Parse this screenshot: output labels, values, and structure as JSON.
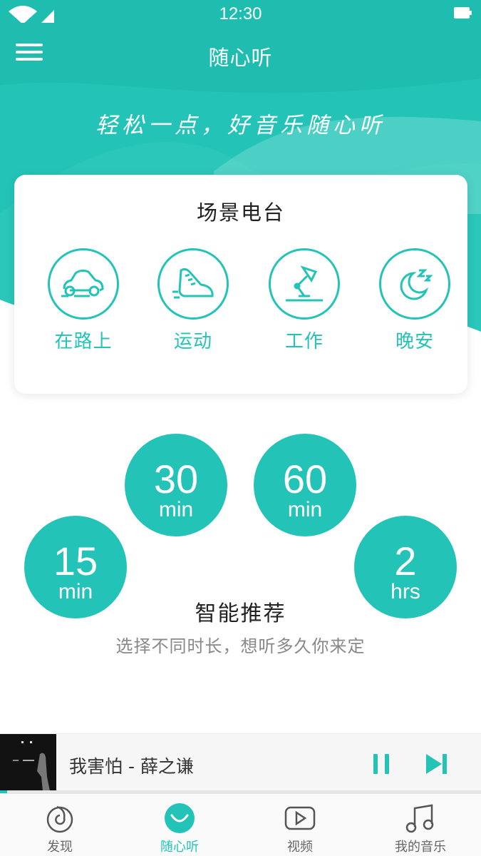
{
  "status_bar": {
    "time": "12:30"
  },
  "nav": {
    "title": "随心听"
  },
  "hero": {
    "slogan": "轻松一点，好音乐随心听"
  },
  "scene_card": {
    "title": "场景电台",
    "items": [
      {
        "label": "在路上",
        "icon": "car-icon"
      },
      {
        "label": "运动",
        "icon": "sneaker-icon"
      },
      {
        "label": "工作",
        "icon": "desk-lamp-icon"
      },
      {
        "label": "晚安",
        "icon": "moon-sleep-icon"
      }
    ]
  },
  "smart_recommend": {
    "title": "智能推荐",
    "subtitle": "选择不同时长，想听多久你来定",
    "durations": [
      {
        "value": "15",
        "unit": "min"
      },
      {
        "value": "30",
        "unit": "min"
      },
      {
        "value": "60",
        "unit": "min"
      },
      {
        "value": "2",
        "unit": "hrs"
      }
    ]
  },
  "player": {
    "song": "我害怕 - 薛之谦",
    "progress": 0.015
  },
  "tabbar": {
    "items": [
      {
        "label": "发现",
        "icon": "discover-icon"
      },
      {
        "label": "随心听",
        "icon": "smile-icon",
        "active": true
      },
      {
        "label": "视频",
        "icon": "video-play-icon"
      },
      {
        "label": "我的音乐",
        "icon": "music-note-icon"
      }
    ]
  },
  "colors": {
    "accent": "#23c4b7",
    "accent_light": "#5fd6cc"
  }
}
